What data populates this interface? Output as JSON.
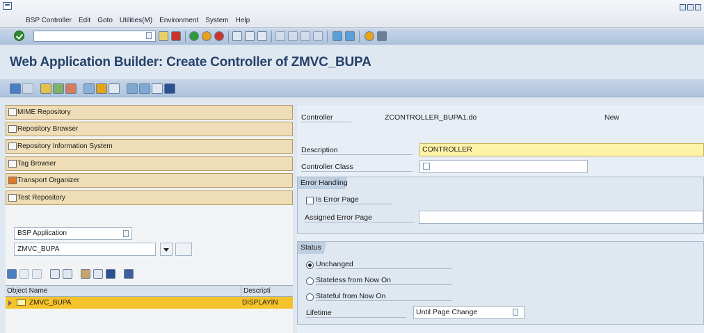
{
  "menubar": {
    "items": [
      "BSP Controller",
      "Edit",
      "Goto",
      "Utilities(M)",
      "Environment",
      "System",
      "Help"
    ]
  },
  "title": "Web Application Builder: Create Controller of ZMVC_BUPA",
  "navigation": {
    "buttons": [
      {
        "label": "MIME Repository",
        "icon": "mime-icon"
      },
      {
        "label": "Repository Browser",
        "icon": "repository-browser-icon"
      },
      {
        "label": "Repository Information System",
        "icon": "info-system-icon"
      },
      {
        "label": "Tag Browser",
        "icon": "tag-browser-icon"
      },
      {
        "label": "Transport Organizer",
        "icon": "transport-icon"
      },
      {
        "label": "Test Repository",
        "icon": "test-repository-icon"
      }
    ]
  },
  "object_selector": {
    "type_value": "BSP Application",
    "name_value": "ZMVC_BUPA"
  },
  "object_tree": {
    "columns": [
      "Object Name",
      "Descripti"
    ],
    "rows": [
      {
        "name": "ZMVC_BUPA",
        "description": "DISPLAYIN"
      }
    ]
  },
  "controller": {
    "label": "Controller",
    "value": "ZCONTROLLER_BUPA1.do",
    "state": "New",
    "description_label": "Description",
    "description_value": "CONTROLLER",
    "class_label": "Controller Class",
    "class_value": ""
  },
  "error_handling": {
    "title": "Error Handling",
    "is_error_page_label": "Is Error Page",
    "is_error_page_checked": false,
    "assigned_error_page_label": "Assigned Error Page",
    "assigned_error_page_value": ""
  },
  "status": {
    "title": "Status",
    "options": [
      "Unchanged",
      "Stateless from Now On",
      "Stateful from Now On"
    ],
    "selected": "Unchanged",
    "lifetime_label": "Lifetime",
    "lifetime_value": "Until Page Change"
  },
  "colors": {
    "nav_button": "#eeddb6",
    "selection": "#f7c32a",
    "title_text": "#27426a"
  }
}
